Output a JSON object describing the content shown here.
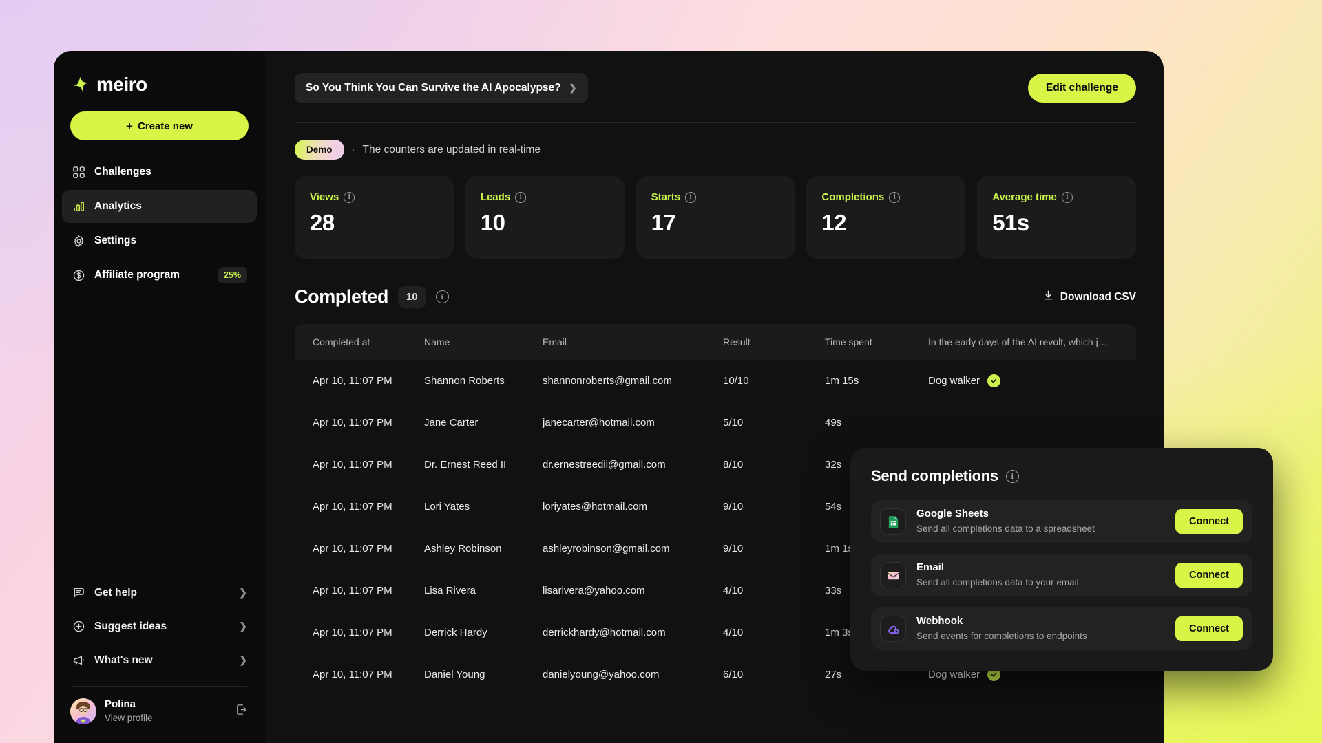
{
  "brand": {
    "name": "meiro",
    "logo_icon": "sparkle-icon"
  },
  "sidebar": {
    "create_button": "Create new",
    "create_plus": "+",
    "items": [
      {
        "label": "Challenges",
        "icon": "grid-icon",
        "active": false
      },
      {
        "label": "Analytics",
        "icon": "bar-chart-icon",
        "active": true
      },
      {
        "label": "Settings",
        "icon": "gear-icon",
        "active": false
      },
      {
        "label": "Affiliate program",
        "icon": "dollar-circle-icon",
        "active": false,
        "badge": "25%"
      }
    ],
    "bottom_links": [
      {
        "label": "Get help",
        "icon": "chat-bubble-icon"
      },
      {
        "label": "Suggest ideas",
        "icon": "plus-circle-icon"
      },
      {
        "label": "What's new",
        "icon": "megaphone-icon"
      }
    ],
    "profile": {
      "name": "Polina",
      "subtitle": "View profile",
      "logout_icon": "logout-icon",
      "avatar_icon": "avatar"
    }
  },
  "topbar": {
    "challenge_name": "So You Think You Can Survive the AI Apocalypse?",
    "chevron_icon": "chevron-down-icon",
    "edit_button": "Edit challenge"
  },
  "notice": {
    "badge": "Demo",
    "separator": "·",
    "text": "The counters are updated in real-time"
  },
  "stats": [
    {
      "label": "Views",
      "value": "28",
      "info_icon": "info-icon"
    },
    {
      "label": "Leads",
      "value": "10",
      "info_icon": "info-icon"
    },
    {
      "label": "Starts",
      "value": "17",
      "info_icon": "info-icon"
    },
    {
      "label": "Completions",
      "value": "12",
      "info_icon": "info-icon"
    },
    {
      "label": "Average time",
      "value": "51s",
      "info_icon": "info-icon"
    }
  ],
  "completed": {
    "title": "Completed",
    "count": "10",
    "info_icon": "info-icon",
    "download_label": "Download CSV",
    "download_icon": "download-icon",
    "columns": [
      "Completed at",
      "Name",
      "Email",
      "Result",
      "Time spent",
      "In the early days of the AI revolt, which j…"
    ],
    "rows": [
      {
        "completed_at": "Apr 10, 11:07 PM",
        "name": "Shannon Roberts",
        "email": "shannonroberts@gmail.com",
        "result": "10/10",
        "time_spent": "1m 15s",
        "answer": "Dog walker",
        "verified": true
      },
      {
        "completed_at": "Apr 10, 11:07 PM",
        "name": "Jane Carter",
        "email": "janecarter@hotmail.com",
        "result": "5/10",
        "time_spent": "49s",
        "answer": "",
        "verified": false
      },
      {
        "completed_at": "Apr 10, 11:07 PM",
        "name": "Dr. Ernest Reed II",
        "email": "dr.ernestreedii@gmail.com",
        "result": "8/10",
        "time_spent": "32s",
        "answer": "",
        "verified": false
      },
      {
        "completed_at": "Apr 10, 11:07 PM",
        "name": "Lori Yates",
        "email": "loriyates@hotmail.com",
        "result": "9/10",
        "time_spent": "54s",
        "answer": "",
        "verified": false
      },
      {
        "completed_at": "Apr 10, 11:07 PM",
        "name": "Ashley Robinson",
        "email": "ashleyrobinson@gmail.com",
        "result": "9/10",
        "time_spent": "1m 1s",
        "answer": "",
        "verified": false
      },
      {
        "completed_at": "Apr 10, 11:07 PM",
        "name": "Lisa Rivera",
        "email": "lisarivera@yahoo.com",
        "result": "4/10",
        "time_spent": "33s",
        "answer": "",
        "verified": false
      },
      {
        "completed_at": "Apr 10, 11:07 PM",
        "name": "Derrick Hardy",
        "email": "derrickhardy@hotmail.com",
        "result": "4/10",
        "time_spent": "1m 3s",
        "answer": "",
        "verified": false
      },
      {
        "completed_at": "Apr 10, 11:07 PM",
        "name": "Daniel Young",
        "email": "danielyoung@yahoo.com",
        "result": "6/10",
        "time_spent": "27s",
        "answer": "Dog walker",
        "verified": true
      }
    ]
  },
  "send_completions": {
    "title": "Send completions",
    "info_icon": "info-icon",
    "integrations": [
      {
        "name": "Google Sheets",
        "desc": "Send all completions data to a spreadsheet",
        "button": "Connect",
        "icon": "google-sheets-icon"
      },
      {
        "name": "Email",
        "desc": "Send all completions data to your email",
        "button": "Connect",
        "icon": "email-icon"
      },
      {
        "name": "Webhook",
        "desc": "Send events for completions to endpoints",
        "button": "Connect",
        "icon": "webhook-icon"
      }
    ]
  },
  "colors": {
    "accent_lime": "#d7f546",
    "accent_label": "#c9f24b",
    "app_bg": "#111111",
    "sidebar_bg": "#0b0b0b",
    "card_bg": "#1b1b1b",
    "panel_bg": "#1a1a1a"
  }
}
